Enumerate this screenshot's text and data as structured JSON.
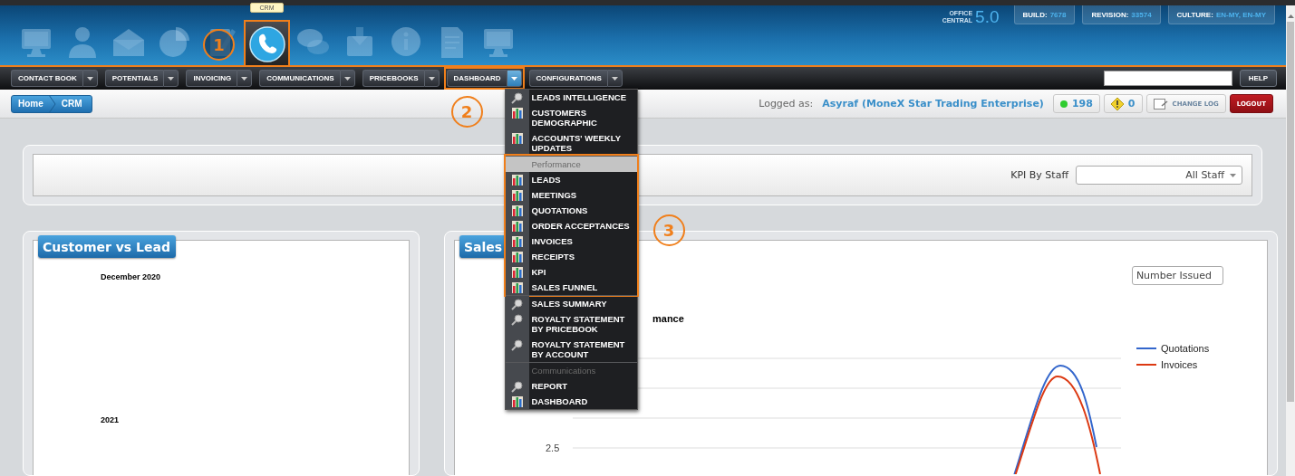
{
  "header": {
    "icons": [
      {
        "kind": "monitor",
        "selected": false
      },
      {
        "kind": "person",
        "selected": false
      },
      {
        "kind": "envelope",
        "selected": false
      },
      {
        "kind": "pie",
        "selected": false
      },
      {
        "kind": "notepad",
        "selected": false,
        "marker": "1"
      },
      {
        "kind": "phone",
        "selected": true,
        "tooltip": "CRM"
      },
      {
        "kind": "chat",
        "selected": false
      },
      {
        "kind": "inbox",
        "selected": false
      },
      {
        "kind": "info",
        "selected": false
      },
      {
        "kind": "document",
        "selected": false
      },
      {
        "kind": "monitor",
        "selected": false
      }
    ],
    "product": {
      "line1": "OFFICE",
      "line2": "CENTRAL",
      "version": "5.0"
    },
    "info": [
      {
        "label": "BUILD:",
        "value": "7678"
      },
      {
        "label": "REVISION:",
        "value": "33574"
      },
      {
        "label": "CULTURE:",
        "value": "EN-MY, EN-MY"
      }
    ]
  },
  "nav": {
    "items": [
      {
        "label": "CONTACT BOOK",
        "selected": false
      },
      {
        "label": "POTENTIALS",
        "selected": false
      },
      {
        "label": "INVOICING",
        "selected": false
      },
      {
        "label": "COMMUNICATIONS",
        "selected": false
      },
      {
        "label": "PRICEBOOKS",
        "selected": false
      },
      {
        "label": "DASHBOARD",
        "selected": true,
        "marker": "2"
      },
      {
        "label": "CONFIGURATIONS",
        "selected": false
      }
    ],
    "help": "HELP"
  },
  "breadcrumb": [
    "Home",
    "CRM"
  ],
  "user": {
    "prefix": "Logged as:",
    "name": "Asyraf (MoneX Star Trading Enterprise)"
  },
  "status": [
    {
      "kind": "online",
      "text": "198"
    },
    {
      "kind": "warning",
      "text": "0"
    },
    {
      "kind": "changelog",
      "text": "CHANGE LOG"
    },
    {
      "kind": "logout",
      "text": "LOGOUT"
    }
  ],
  "filter": {
    "label": "KPI By Staff",
    "value": "All Staff"
  },
  "left_card": {
    "title": "Customer vs Lead",
    "labels": [
      "December 2020",
      "2021"
    ]
  },
  "right_card": {
    "title": "Sales",
    "select": "Number Issued",
    "chart_title": "mance",
    "y_tick": "2.5",
    "legend": [
      {
        "name": "Quotations",
        "color": "#3366cc"
      },
      {
        "name": "Invoices",
        "color": "#dc3912"
      }
    ]
  },
  "menu": {
    "groups": [
      {
        "highlighted": false,
        "items": [
          {
            "label": "LEADS INTELLIGENCE",
            "kind": "search"
          },
          {
            "label": "CUSTOMERS DEMOGRAPHIC",
            "kind": "chart"
          },
          {
            "label": "ACCOUNTS' WEEKLY UPDATES",
            "kind": "chart"
          }
        ]
      },
      {
        "header": "Performance",
        "highlighted": true,
        "marker": "3",
        "items": [
          {
            "label": "LEADS",
            "kind": "chart"
          },
          {
            "label": "MEETINGS",
            "kind": "chart"
          },
          {
            "label": "QUOTATIONS",
            "kind": "chart"
          },
          {
            "label": "ORDER ACCEPTANCES",
            "kind": "chart"
          },
          {
            "label": "INVOICES",
            "kind": "chart"
          },
          {
            "label": "RECEIPTS",
            "kind": "chart"
          },
          {
            "label": "KPI",
            "kind": "chart"
          },
          {
            "label": "SALES FUNNEL",
            "kind": "chart"
          }
        ]
      },
      {
        "highlighted": false,
        "items": [
          {
            "label": "SALES SUMMARY",
            "kind": "search"
          },
          {
            "label": "ROYALTY STATEMENT BY PRICEBOOK",
            "kind": "search"
          },
          {
            "label": "ROYALTY STATEMENT BY ACCOUNT",
            "kind": "search"
          }
        ]
      },
      {
        "header": "Communications",
        "highlighted": false,
        "items": [
          {
            "label": "REPORT",
            "kind": "search"
          },
          {
            "label": "DASHBOARD",
            "kind": "chart"
          }
        ]
      }
    ]
  }
}
